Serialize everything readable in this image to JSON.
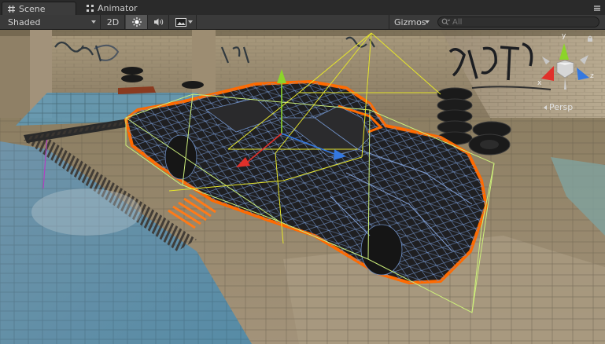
{
  "tabs": [
    {
      "label": "Scene",
      "icon": "scene-grid-icon",
      "active": true
    },
    {
      "label": "Animator",
      "icon": "animator-icon",
      "active": false
    }
  ],
  "toolbar": {
    "draw_mode": "Shaded",
    "mode_2d_label": "2D",
    "lighting_icon": "sun-icon",
    "audio_icon": "speaker-icon",
    "effects_icon": "image-icon",
    "gizmos_label": "Gizmos",
    "search_placeholder": "All"
  },
  "viewport": {
    "projection_label": "Persp",
    "axis_labels": {
      "x": "x",
      "y": "y",
      "z": "z"
    },
    "colors": {
      "selection_outline": "#ff6a00",
      "wireframe": "#6f8fc4",
      "bounds_box": "#cdf07a",
      "camera_frustum": "#e6e62b",
      "axis_x": "#e0302a",
      "axis_y": "#8cd42a",
      "axis_z": "#3478e0"
    }
  }
}
